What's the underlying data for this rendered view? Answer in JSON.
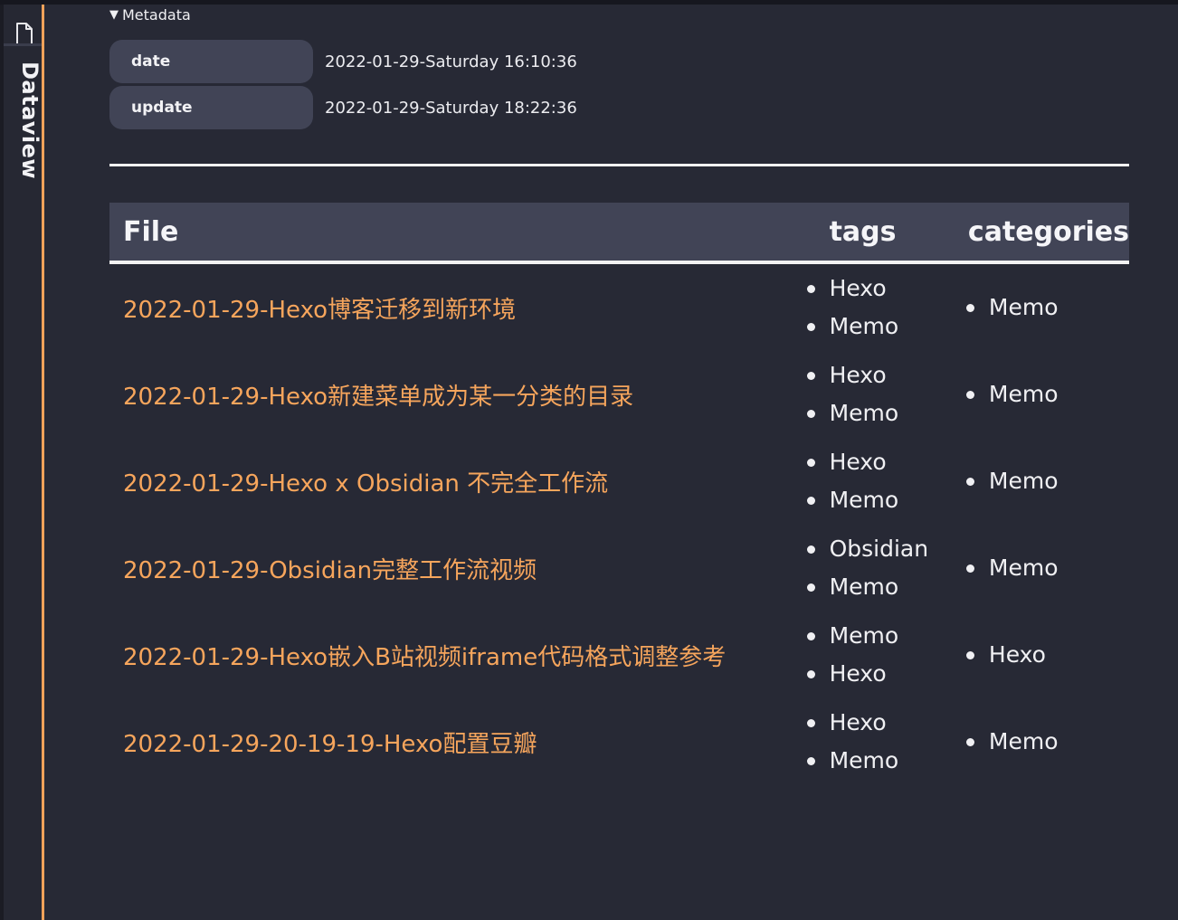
{
  "sidebar": {
    "tab_label": "Dataview",
    "file_icon": "file-icon"
  },
  "metadata": {
    "toggle_label": "Metadata",
    "rows": [
      {
        "key": "date",
        "value": "2022-01-29-Saturday 16:10:36"
      },
      {
        "key": "update",
        "value": "2022-01-29-Saturday 18:22:36"
      }
    ]
  },
  "table": {
    "headers": {
      "file": "File",
      "tags": "tags",
      "categories": "categories"
    },
    "rows": [
      {
        "file": "2022-01-29-Hexo博客迁移到新环境",
        "tags": [
          "Hexo",
          "Memo"
        ],
        "categories": [
          "Memo"
        ]
      },
      {
        "file": "2022-01-29-Hexo新建菜单成为某一分类的目录",
        "tags": [
          "Hexo",
          "Memo"
        ],
        "categories": [
          "Memo"
        ]
      },
      {
        "file": "2022-01-29-Hexo x Obsidian 不完全工作流",
        "tags": [
          "Hexo",
          "Memo"
        ],
        "categories": [
          "Memo"
        ]
      },
      {
        "file": "2022-01-29-Obsidian完整工作流视频",
        "tags": [
          "Obsidian",
          "Memo"
        ],
        "categories": [
          "Memo"
        ]
      },
      {
        "file": "2022-01-29-Hexo嵌入B站视频iframe代码格式调整参考",
        "tags": [
          "Memo",
          "Hexo"
        ],
        "categories": [
          "Hexo"
        ]
      },
      {
        "file": "2022-01-29-20-19-19-Hexo配置豆瓣",
        "tags": [
          "Hexo",
          "Memo"
        ],
        "categories": [
          "Memo"
        ]
      }
    ]
  },
  "colors": {
    "background": "#272935",
    "accent": "#f0a25a",
    "link": "#f6a55c",
    "header_bg": "#414456"
  }
}
